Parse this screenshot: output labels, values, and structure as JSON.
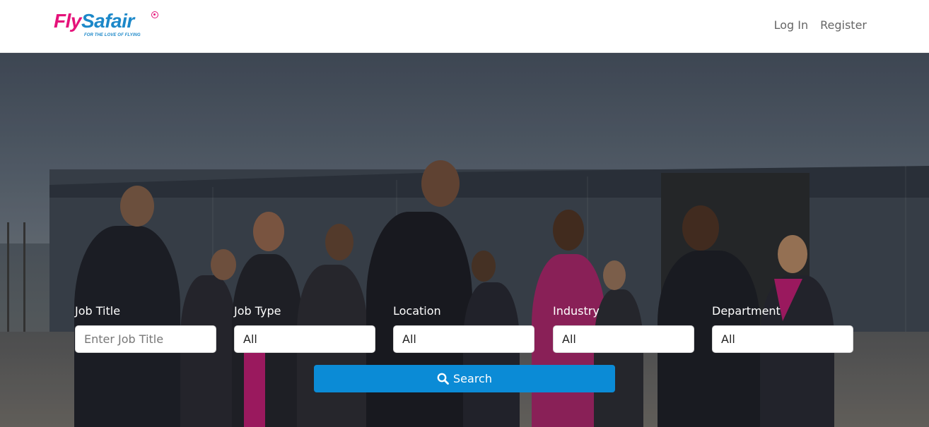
{
  "brand": {
    "name_part1": "Fly",
    "name_part2": "Safair",
    "tagline": "FOR THE LOVE OF FLYING"
  },
  "nav": {
    "login": "Log In",
    "register": "Register"
  },
  "search": {
    "job_title": {
      "label": "Job Title",
      "placeholder": "Enter Job Title"
    },
    "job_type": {
      "label": "Job Type",
      "value": "All"
    },
    "location": {
      "label": "Location",
      "value": "All"
    },
    "industry": {
      "label": "Industry",
      "value": "All"
    },
    "department": {
      "label": "Department",
      "value": "All"
    },
    "button_label": "Search",
    "button_icon": "search-icon"
  },
  "colors": {
    "brand_pink": "#e5127a",
    "brand_blue": "#1c88c9",
    "search_button": "#0b8bd6"
  }
}
